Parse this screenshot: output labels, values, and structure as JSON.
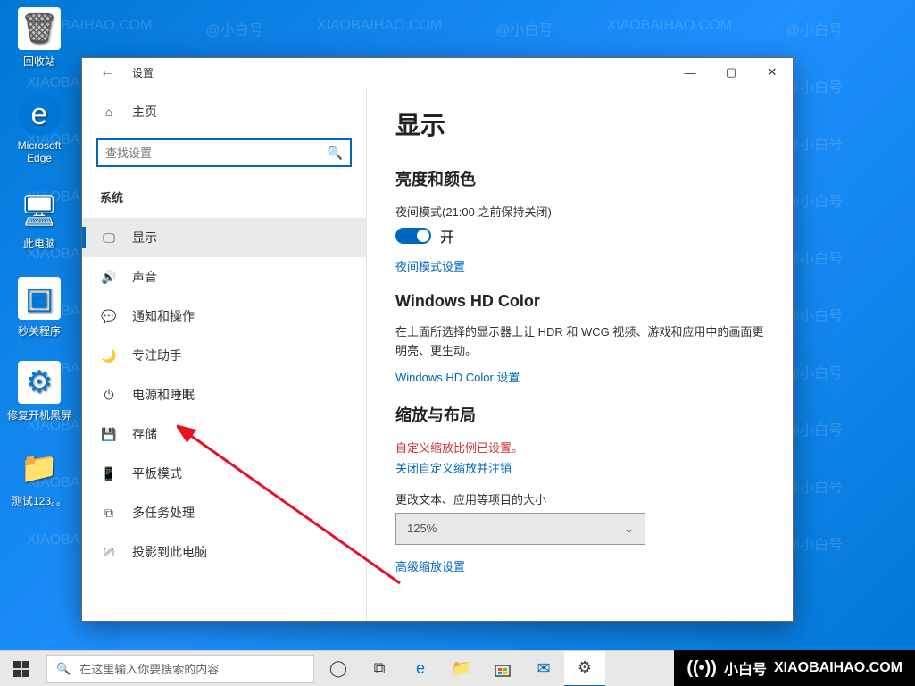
{
  "desktop": {
    "icons": [
      {
        "label": "回收站",
        "kind": "bin"
      },
      {
        "label": "Microsoft Edge",
        "kind": "edge"
      },
      {
        "label": "此电脑",
        "kind": "pc"
      },
      {
        "label": "秒关程序",
        "kind": "app"
      },
      {
        "label": "修复开机黑屏",
        "kind": "app"
      },
      {
        "label": "测试123。。",
        "kind": "folder"
      }
    ],
    "watermark_text": "XIAOBAIHAO.COM",
    "watermark_cn": "@小白号"
  },
  "settings": {
    "window_title": "设置",
    "home": "主页",
    "search_placeholder": "查找设置",
    "category": "系统",
    "nav": [
      {
        "icon": "🖵",
        "label": "显示",
        "selected": true,
        "name": "nav-display"
      },
      {
        "icon": "🔊",
        "label": "声音",
        "name": "nav-sound"
      },
      {
        "icon": "💬",
        "label": "通知和操作",
        "name": "nav-notifications"
      },
      {
        "icon": "🌙",
        "label": "专注助手",
        "name": "nav-focus-assist"
      },
      {
        "icon": "⏻",
        "label": "电源和睡眠",
        "name": "nav-power-sleep"
      },
      {
        "icon": "💾",
        "label": "存储",
        "name": "nav-storage"
      },
      {
        "icon": "📱",
        "label": "平板模式",
        "name": "nav-tablet"
      },
      {
        "icon": "⧉",
        "label": "多任务处理",
        "name": "nav-multitask"
      },
      {
        "icon": "⎚",
        "label": "投影到此电脑",
        "name": "nav-project"
      }
    ],
    "content": {
      "heading": "显示",
      "brightness_h": "亮度和颜色",
      "night_light_label": "夜间模式(21:00 之前保持关闭)",
      "toggle_on": "开",
      "night_light_link": "夜间模式设置",
      "hdcolor_h": "Windows HD Color",
      "hdcolor_desc": "在上面所选择的显示器上让 HDR 和 WCG 视频、游戏和应用中的画面更明亮、更生动。",
      "hdcolor_link": "Windows HD Color 设置",
      "scale_h": "缩放与布局",
      "scale_warning": "自定义缩放比例已设置。",
      "scale_logout": "关闭自定义缩放并注销",
      "scale_label": "更改文本、应用等项目的大小",
      "scale_value": "125%",
      "advanced_link": "高级缩放设置"
    }
  },
  "taskbar": {
    "search_placeholder": "在这里输入你要搜索的内容"
  },
  "brand": {
    "name": "小白号",
    "domain": "XIAOBAIHAO.COM"
  }
}
